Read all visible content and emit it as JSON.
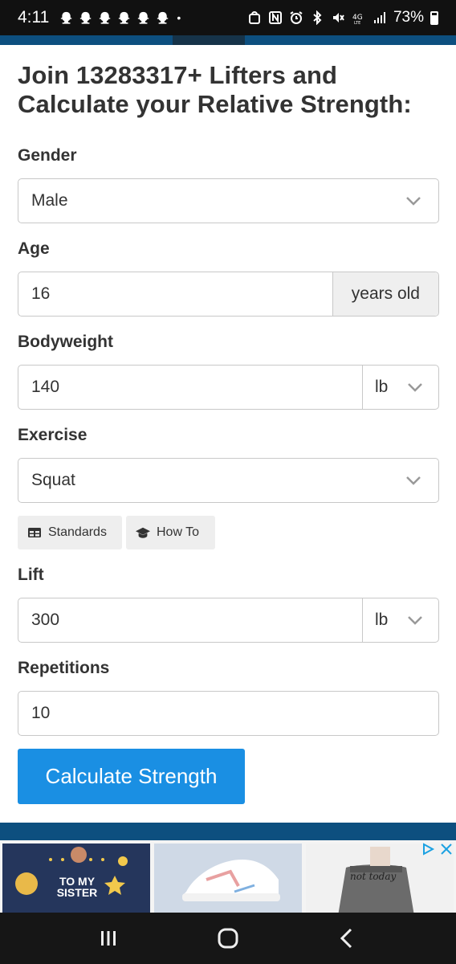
{
  "status_bar": {
    "time": "4:11",
    "dot": "•",
    "battery": "73%",
    "icons": [
      "snapchat-icon",
      "snapchat-icon",
      "snapchat-icon",
      "snapchat-icon",
      "snapchat-icon",
      "snapchat-icon",
      "bag-icon",
      "nfc-icon",
      "alarm-icon",
      "bluetooth-icon",
      "mute-icon",
      "lte-icon",
      "signal-icon",
      "battery-icon"
    ]
  },
  "form": {
    "headline": "Join 13283317+ Lifters and Calculate your Relative Strength:",
    "gender": {
      "label": "Gender",
      "value": "Male"
    },
    "age": {
      "label": "Age",
      "value": "16",
      "suffix": "years old"
    },
    "bodyweight": {
      "label": "Bodyweight",
      "value": "140",
      "unit": "lb"
    },
    "exercise": {
      "label": "Exercise",
      "value": "Squat"
    },
    "standards_label": "Standards",
    "howto_label": "How To",
    "lift": {
      "label": "Lift",
      "value": "300",
      "unit": "lb"
    },
    "repetitions": {
      "label": "Repetitions",
      "value": "10"
    },
    "calculate_label": "Calculate Strength"
  },
  "ad": {
    "tile1_text": "TO MY SISTER",
    "tile3_text": "not today"
  },
  "colors": {
    "accent": "#1a8fe3",
    "header_blue": "#0d4f7f"
  }
}
